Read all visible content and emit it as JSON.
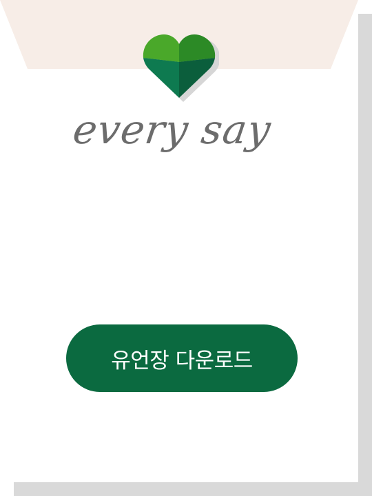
{
  "brand": {
    "name": "every say",
    "logo_icon": "heart-icon",
    "colors": {
      "heart_light": "#4aa82a",
      "heart_mid": "#2c8a26",
      "heart_dark_left": "#0e7a50",
      "heart_dark_right": "#0b5e3c",
      "wordmark": "#6c6c6c",
      "top_band": "#f7ede7"
    }
  },
  "main": {
    "download_button_label": "유언장 다운로드",
    "button_color": "#0b6a40"
  },
  "frame": {
    "shadow_color": "#d9d9d9"
  }
}
